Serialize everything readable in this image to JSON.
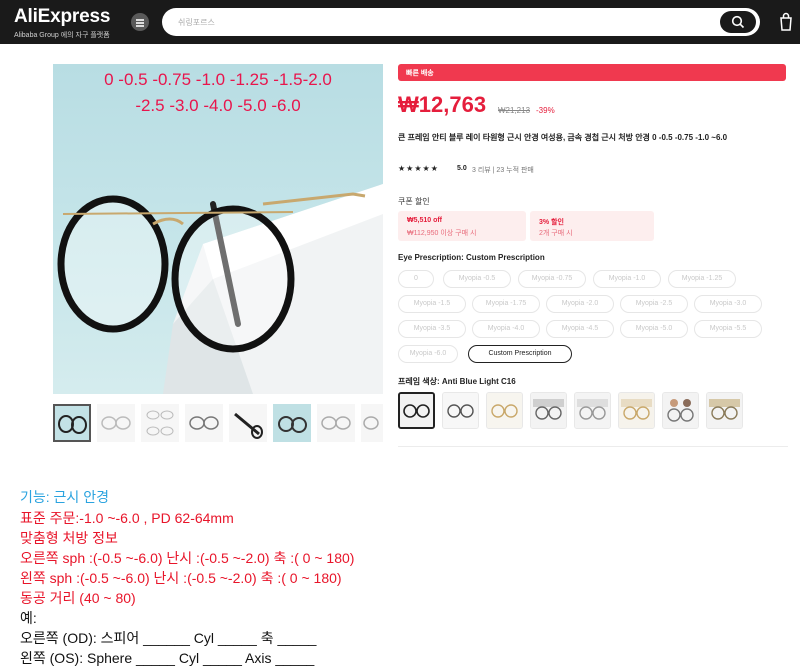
{
  "header": {
    "logo": "AliExpress",
    "logo_sub": "Alibaba Group 에의 자구 플랫폼",
    "search_placeholder": "쉬링포르스"
  },
  "gallery": {
    "range_line1": "0 -0.5 -0.75 -1.0 -1.25 -1.5-2.0",
    "range_line2": "-2.5 -3.0 -4.0 -5.0 -6.0",
    "thumb_count": 8
  },
  "product": {
    "deal_banner": "빠른 배송",
    "price": "₩12,763",
    "old_price": "₩21,213",
    "discount": "-39%",
    "title": "큰 프레임 안티 블루 레이 타원형 근시 안경 여성용, 금속 경첩 근시 처방 안경 0 -0.5 -0.75 -1.0 ~6.0",
    "stars": "★★★★★",
    "rating": "5.0",
    "reviews": "3 리뷰 | 23 누적 판매"
  },
  "coupons": {
    "label": "쿠폰 할인",
    "items": [
      {
        "line1": "₩5,510 off",
        "line2": "₩112,950 이상 구매 시"
      },
      {
        "line1": "3% 할인",
        "line2": "2개 구매 시"
      }
    ]
  },
  "prescription": {
    "label": "Eye Prescription: Custom Prescription",
    "options": [
      "0",
      "Myopia -0.5",
      "Myopia -0.75",
      "Myopia -1.0",
      "Myopia -1.25",
      "Myopia -1.5",
      "Myopia -1.75",
      "Myopia -2.0",
      "Myopia -2.5",
      "Myopia -3.0",
      "Myopia -3.5",
      "Myopia -4.0",
      "Myopia -4.5",
      "Myopia -5.0",
      "Myopia -5.5",
      "Myopia -6.0",
      "Custom Prescription"
    ],
    "selected": "Custom Prescription"
  },
  "frame_color": {
    "label": "프레임 색상: Anti Blue Light C16",
    "swatch_count": 8
  },
  "description": {
    "l1": "기능: 근시 안경",
    "l2": "표준 주문:-1.0 ~-6.0 , PD 62-64mm",
    "l3": "맞춤형 처방 정보",
    "l4": "오른쪽 sph :(-0.5 ~-6.0) 난시 :(-0.5 ~-2.0) 축 :( 0 ~ 180)",
    "l5": "왼쪽 sph :(-0.5 ~-6.0) 난시 :(-0.5 ~-2.0) 축 :( 0 ~ 180)",
    "l6": "동공 거리 (40 ~ 80)",
    "l7": "예:",
    "l8": "오른쪽 (OD): 스피어 ______ Cyl _____ 축 _____",
    "l9": "왼쪽 (OS): Sphere _____ Cyl _____ Axis _____"
  },
  "colors": {
    "header_bg": "#1a1a1a",
    "price": "#e51e3c",
    "accent_red": "#f0394f",
    "desc_blue": "#2aa3df",
    "desc_red": "#e8152a"
  }
}
